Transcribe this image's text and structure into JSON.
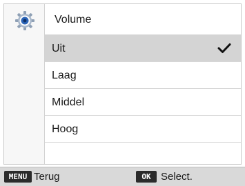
{
  "menu": {
    "category_icon": "gear-icon",
    "title": "Volume",
    "items": [
      {
        "label": "Uit",
        "selected": true
      },
      {
        "label": "Laag",
        "selected": false
      },
      {
        "label": "Middel",
        "selected": false
      },
      {
        "label": "Hoog",
        "selected": false
      },
      {
        "label": "",
        "selected": false
      }
    ],
    "selected_icon": "checkmark-icon"
  },
  "footer": {
    "menu_key": "MENU",
    "menu_hint": "Terug",
    "ok_key": "OK",
    "ok_hint": "Select."
  },
  "colors": {
    "selected_row": "#d4d4d4",
    "icon_blue": "#2a64b8",
    "footer_bg": "#d9d9d9"
  }
}
